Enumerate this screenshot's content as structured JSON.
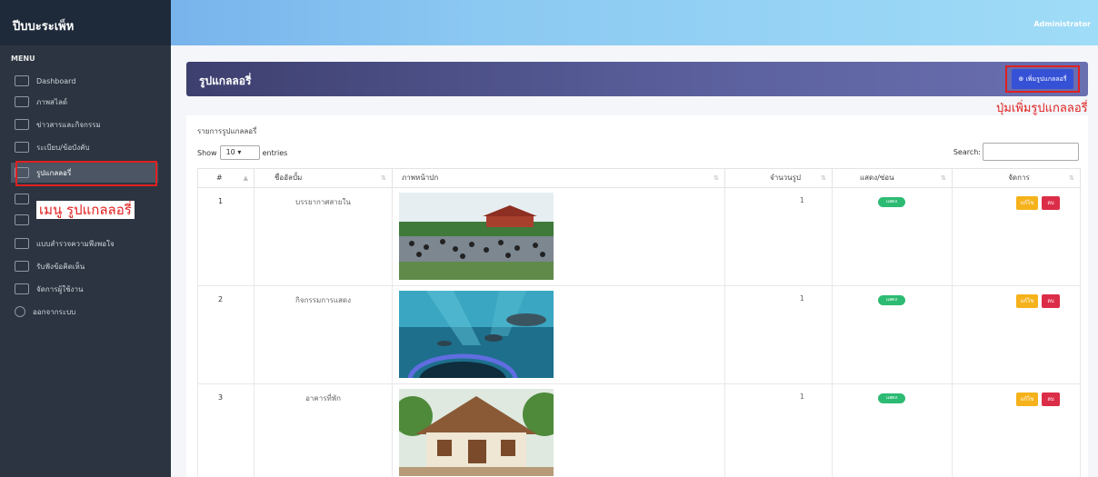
{
  "brand": "ปีบบะระเพ็ห",
  "topbar": {
    "user": "Administrator"
  },
  "sidebar": {
    "title": "MENU",
    "items": [
      {
        "label": "Dashboard",
        "icon": "monitor-icon"
      },
      {
        "label": "ภาพสไลด์",
        "icon": "slides-icon"
      },
      {
        "label": "ข่าวสารและกิจกรรม",
        "icon": "news-icon"
      },
      {
        "label": "ระเบียบ/ข้อบังคับ",
        "icon": "rules-icon"
      },
      {
        "label": "รูปแกลลอรี่",
        "icon": "gallery-icon"
      },
      {
        "label": "",
        "icon": "document-icon"
      },
      {
        "label": "",
        "icon": "file-icon"
      },
      {
        "label": "แบบสำรวจความพึงพอใจ",
        "icon": "survey-icon"
      },
      {
        "label": "รับฟังข้อคิดเห็น",
        "icon": "phone-icon"
      },
      {
        "label": "จัดการผู้ใช้งาน",
        "icon": "users-icon"
      },
      {
        "label": "ออกจากระบบ",
        "icon": "power-icon"
      }
    ],
    "annotation": "เมนู รูปแกลลอรี่"
  },
  "header": {
    "title": "รูปแกลลอรี่",
    "add_button": "⊕ เพิ่มรูปแกลลอรี่",
    "add_annotation": "ปุ่มเพิ่มรูปแกลลอรี่"
  },
  "table": {
    "caption": "รายการรูปแกลลอรี่",
    "show_label": "Show",
    "page_size": "10",
    "entries_label": "entries",
    "search_label": "Search:",
    "columns": [
      "#",
      "ชื่ออัลบั้ม",
      "ภาพหน้าปก",
      "จำนวนรูป",
      "แสดง/ซ่อน",
      "จัดการ"
    ],
    "rows": [
      {
        "num": "1",
        "album": "บรรยากาศสายใน",
        "count": "1",
        "status": "แสดง",
        "edit": "แก้ไข",
        "delete": "ลบ"
      },
      {
        "num": "2",
        "album": "กิจกรรมการแสดง",
        "count": "1",
        "status": "แสดง",
        "edit": "แก้ไข",
        "delete": "ลบ"
      },
      {
        "num": "3",
        "album": "อาคารที่พัก",
        "count": "1",
        "status": "แสดง",
        "edit": "แก้ไข",
        "delete": "ลบ"
      }
    ]
  },
  "colors": {
    "accent": "#3551d6",
    "highlight": "#e02020",
    "badge": "#2dbb73",
    "edit": "#f5b21b",
    "delete": "#dc2d48"
  }
}
